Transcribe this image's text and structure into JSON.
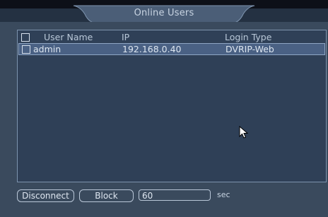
{
  "window": {
    "title": "Online Users"
  },
  "table": {
    "columns": {
      "user_name": "User Name",
      "ip": "IP",
      "login_type": "Login Type"
    },
    "rows": [
      {
        "user_name": "admin",
        "ip": "192.168.0.40",
        "login_type": "DVRIP-Web",
        "checked": false,
        "selected": true
      }
    ]
  },
  "actions": {
    "disconnect_label": "Disconnect",
    "block_label": "Block",
    "block_time_value": "60",
    "block_time_unit": "sec"
  },
  "icons": {
    "pointer": "mouse-pointer-icon"
  },
  "colors": {
    "window_bg": "#3a4a5d",
    "panel_bg": "#2f4057",
    "selected_row_bg": "#4a6184",
    "title_bar_bg": "#4b5e77",
    "text": "#dde6f0"
  }
}
